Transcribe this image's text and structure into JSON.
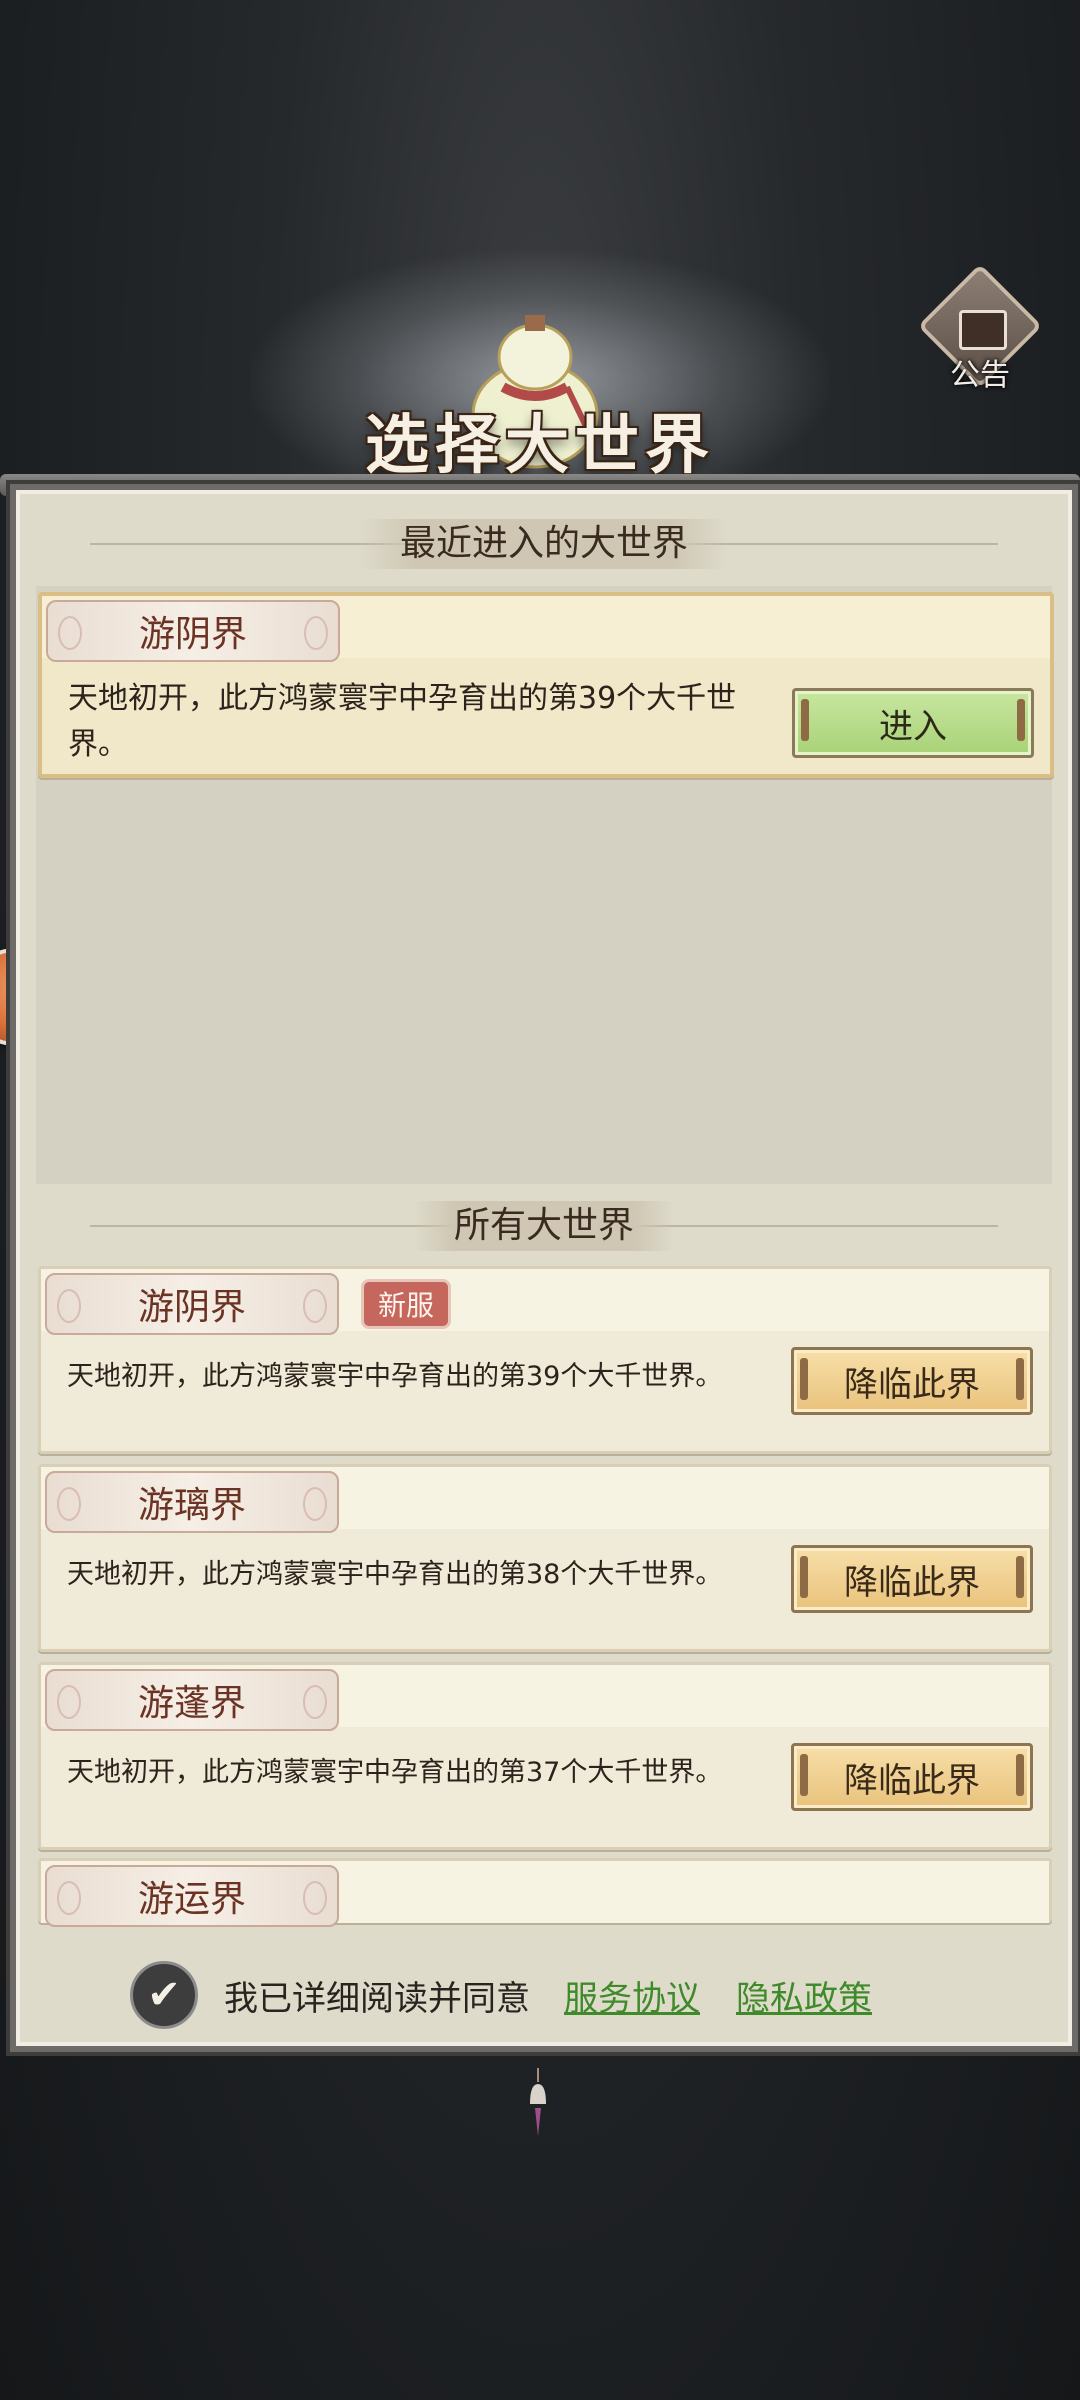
{
  "header": {
    "title": "选择大世界",
    "notice_label": "公告"
  },
  "recent": {
    "section_title": "最近进入的大世界",
    "world": {
      "name": "游阴界",
      "description": "天地初开，此方鸿蒙寰宇中孕育出的第39个大千世界。",
      "button_label": "进入"
    }
  },
  "all_worlds": {
    "section_title": "所有大世界",
    "items": [
      {
        "name": "游阴界",
        "badge": "新服",
        "description": "天地初开，此方鸿蒙寰宇中孕育出的第39个大千世界。",
        "button_label": "降临此界"
      },
      {
        "name": "游璃界",
        "badge": "",
        "description": "天地初开，此方鸿蒙寰宇中孕育出的第38个大千世界。",
        "button_label": "降临此界"
      },
      {
        "name": "游蓬界",
        "badge": "",
        "description": "天地初开，此方鸿蒙寰宇中孕育出的第37个大千世界。",
        "button_label": "降临此界"
      },
      {
        "name": "游运界",
        "badge": "",
        "description": "",
        "button_label": ""
      }
    ]
  },
  "agreement": {
    "checked": true,
    "text": "我已详细阅读并同意",
    "service_link": "服务协议",
    "privacy_link": "隐私政策"
  },
  "colors": {
    "panel_bg": "#dedbcb",
    "enter_button": "#b5da88",
    "descend_button": "#f0d08f",
    "link_green": "#3f8a2a",
    "badge_red": "#c6675d"
  }
}
